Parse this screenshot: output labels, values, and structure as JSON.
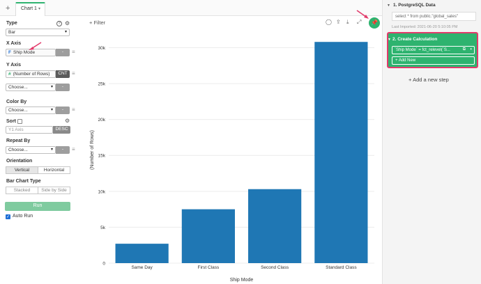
{
  "tabs": {
    "add_label": "+",
    "items": [
      {
        "label": "Chart 1"
      }
    ]
  },
  "config": {
    "type": {
      "label": "Type",
      "value": "Bar"
    },
    "x_axis": {
      "label": "X Axis",
      "field": "Ship Mode",
      "field_icon": "F",
      "agg": "-"
    },
    "y_axis": {
      "label": "Y Axis",
      "field": "(Number of Rows)",
      "field_icon": "#",
      "agg": "CNT"
    },
    "y_axis_extra": {
      "value": "Choose...",
      "agg": "-"
    },
    "color_by": {
      "label": "Color By",
      "value": "Choose...",
      "agg": "-"
    },
    "sort": {
      "label": "Sort",
      "placeholder": "Y1 Axis",
      "order": "DESC"
    },
    "repeat_by": {
      "label": "Repeat By",
      "value": "Choose...",
      "agg": "-"
    },
    "orientation": {
      "label": "Orientation",
      "options": [
        "Vertical",
        "Horizontal"
      ],
      "selected": "Vertical"
    },
    "bar_chart_type": {
      "label": "Bar Chart Type",
      "options": [
        "Stacked",
        "Side by Side"
      ]
    },
    "run_label": "Run",
    "auto_run": {
      "label": "Auto Run",
      "checked": true
    }
  },
  "toolbar": {
    "filter_label": "Filter",
    "icons": [
      "comment-icon",
      "share-icon",
      "download-icon",
      "expand-icon"
    ]
  },
  "steps": {
    "step1": {
      "title": "1. PostgreSQL Data",
      "sql": "select * from public.\"global_sales\"",
      "last_imported": "Last Imported: 2021-06-20 5:10:05 PM"
    },
    "step2": {
      "title": "2. Create Calculation",
      "expression": "`Ship Mode` = fct_relevel(`S...",
      "add_label": "+ Add New"
    },
    "add_step_label": "Add a new step"
  },
  "colors": {
    "accent": "#2eb36f",
    "bar": "#1f77b4",
    "highlight": "#e23b6b"
  },
  "chart_data": {
    "type": "bar",
    "categories": [
      "Same Day",
      "First Class",
      "Second Class",
      "Standard Class"
    ],
    "values": [
      2700,
      7500,
      10300,
      30800
    ],
    "xlabel": "Ship Mode",
    "ylabel": "(Number of Rows)",
    "ylim": [
      0,
      31500
    ],
    "yticks": [
      0,
      5000,
      10000,
      15000,
      20000,
      25000,
      30000
    ],
    "ytick_labels": [
      "0",
      "5k",
      "10k",
      "15k",
      "20k",
      "25k",
      "30k"
    ],
    "grid": true,
    "legend": "none"
  }
}
